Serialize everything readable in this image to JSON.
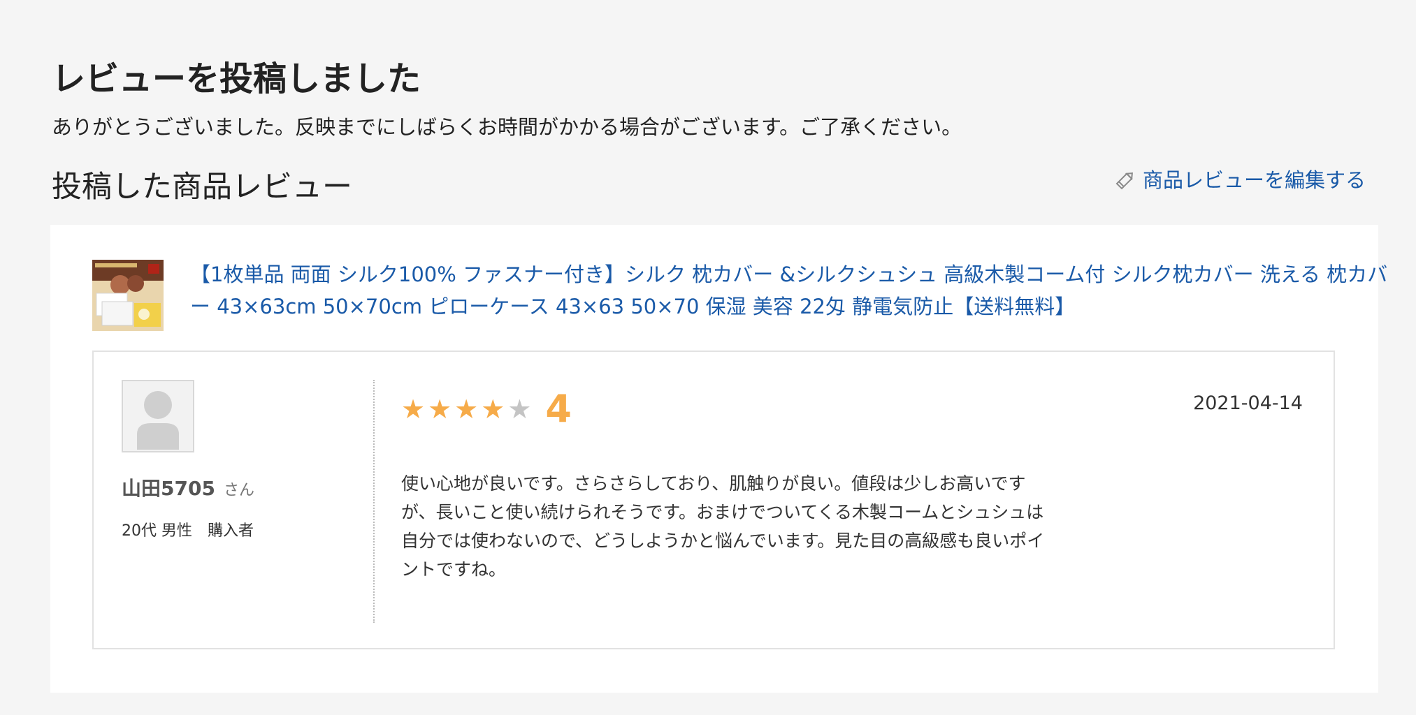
{
  "header": {
    "title": "レビューを投稿しました",
    "thanks_message": "ありがとうございました。反映までにしばらくお時間がかかる場合がございます。ご了承ください。"
  },
  "section": {
    "title": "投稿した商品レビュー",
    "edit_link_label": "商品レビューを編集する",
    "edit_icon": "pencil-icon"
  },
  "product": {
    "name": "【1枚単品 両面 シルク100% ファスナー付き】シルク 枕カバー &シルクシュシュ 高級木製コーム付 シルク枕カバー 洗える 枕カバー 43×63cm 50×70cm ピローケース 43×63 50×70 保湿 美容 22匁 静電気防止【送料無料】",
    "thumbnail_icon": "product-thumbnail"
  },
  "review": {
    "reviewer_name": "山田5705",
    "reviewer_suffix": "さん",
    "reviewer_meta": "20代 男性　購入者",
    "rating": 4,
    "rating_max": 5,
    "score_label": "4",
    "date": "2021-04-14",
    "body": "使い心地が良いです。さらさらしており、肌触りが良い。値段は少しお高いですが、長いこと使い続けられそうです。おまけでついてくる木製コームとシュシュは自分では使わないので、どうしようかと悩んでいます。見た目の高級感も良いポイントですね。",
    "star_color_on": "#f6ab49",
    "star_color_off": "#c4c4c4"
  },
  "colors": {
    "link": "#1a5aa8",
    "accent": "#f6ab49",
    "background": "#f5f5f5"
  }
}
